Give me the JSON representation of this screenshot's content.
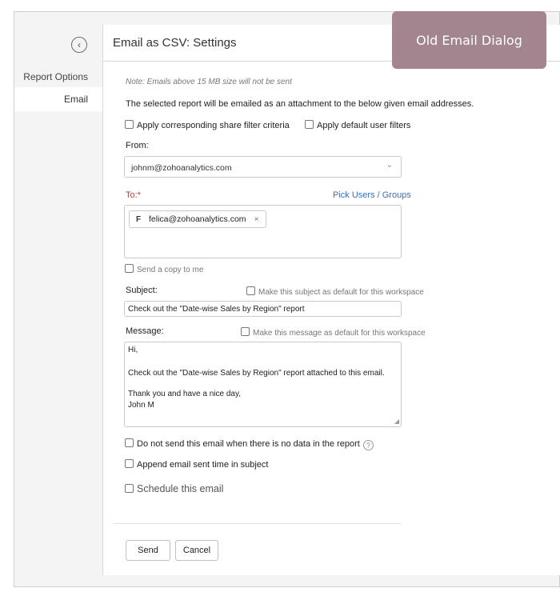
{
  "sidebar": {
    "back_icon_glyph": "‹",
    "items": [
      {
        "label": "Report Options"
      },
      {
        "label": "Email"
      }
    ]
  },
  "dialog": {
    "title": "Email as CSV: Settings"
  },
  "badge": {
    "label": "Old Email Dialog",
    "color": "#a2858f"
  },
  "form": {
    "note": "Note:  Emails above 15 MB size will not be sent",
    "description": "The selected report will be emailed as an attachment to the below given email addresses.",
    "share_filter_label": "Apply corresponding share filter criteria",
    "default_user_filters_label": "Apply default user filters",
    "from_label": "From:",
    "from_value": "johnm@zohoanalytics.com",
    "to_label": "To:*",
    "pick_users_link": "Pick Users / Groups",
    "recipients": [
      {
        "initial": "F",
        "email": "felica@zohoanalytics.com"
      }
    ],
    "send_copy_label": "Send a copy to me",
    "subject_label": "Subject:",
    "subject_default_label": "Make this subject as default for this workspace",
    "subject_value": "Check out the \"Date-wise Sales by Region\" report",
    "message_label": "Message:",
    "message_default_label": "Make this message as default for this workspace",
    "message_lines": [
      "Hi,",
      "Check out the \"Date-wise Sales by Region\" report attached to this email.",
      "Thank you and have a nice day,",
      "John M"
    ],
    "no_data_label": "Do not send this email when there is no data in the report",
    "append_time_label": "Append email sent time in subject",
    "schedule_label": "Schedule this email"
  },
  "buttons": {
    "send": "Send",
    "cancel": "Cancel"
  },
  "colors": {
    "link": "#3b6fb6",
    "required_label": "#b0413e"
  }
}
